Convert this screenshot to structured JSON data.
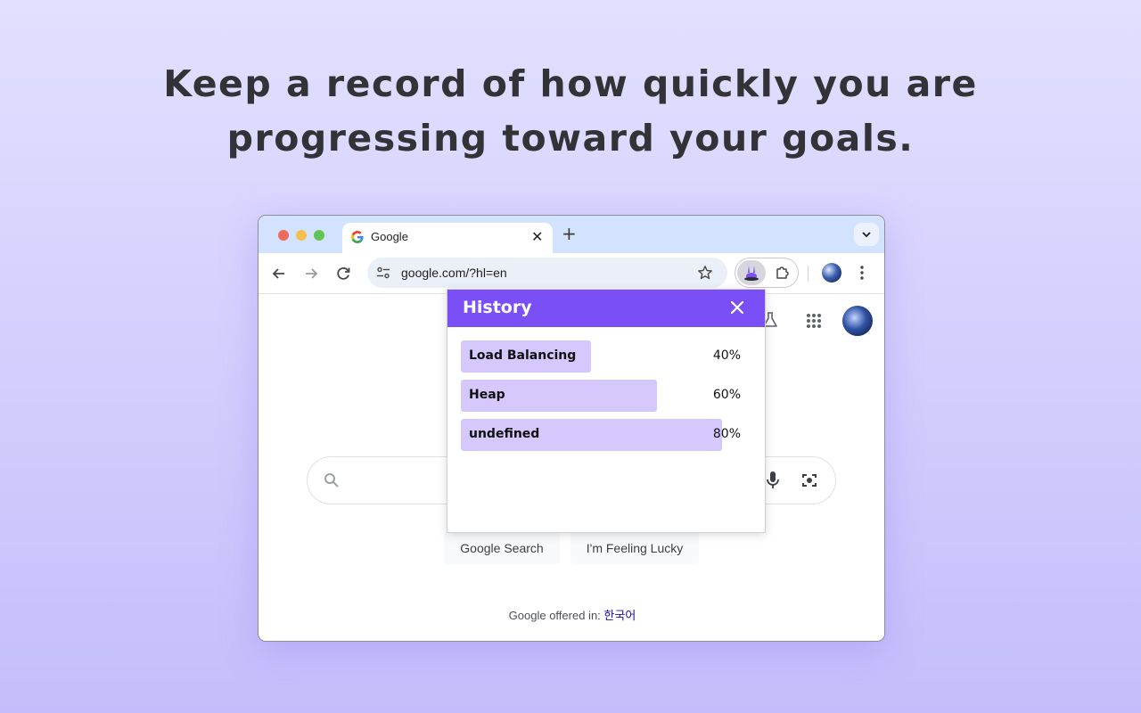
{
  "headline": {
    "line1": "Keep a record of how quickly you are",
    "line2": "progressing toward your goals."
  },
  "browser": {
    "tab": {
      "title": "Google",
      "icon": "google-g-icon"
    },
    "omnibox": {
      "url": "google.com/?hl=en"
    }
  },
  "google": {
    "search_button": "Google Search",
    "lucky_button": "I'm Feeling Lucky",
    "offered_in_label": "Google offered in:",
    "offered_language": "한국어"
  },
  "popup": {
    "title": "History",
    "accent_color": "#7a4ff6",
    "bar_color": "#d6c7fc",
    "items": [
      {
        "label": "Load Balancing",
        "percent_text": "40%",
        "progress": 0.4
      },
      {
        "label": "Heap",
        "percent_text": "60%",
        "progress": 0.6
      },
      {
        "label": "undefined",
        "percent_text": "80%",
        "progress": 0.8
      }
    ]
  }
}
